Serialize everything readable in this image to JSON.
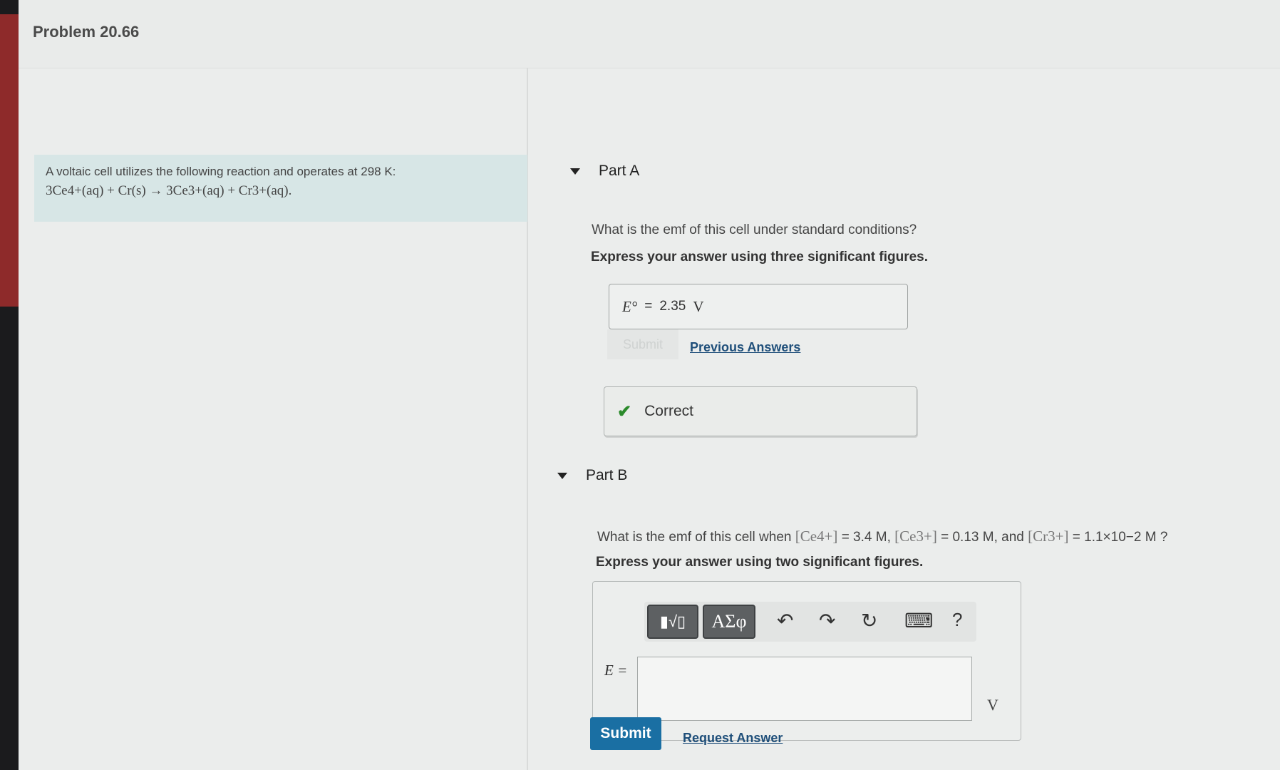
{
  "problem": {
    "title": "Problem 20.66"
  },
  "intro": {
    "text": "A voltaic cell utilizes the following reaction and operates at 298 K:",
    "equation": "3Ce4+(aq) + Cr(s) → 3Ce3+(aq) + Cr3+(aq)."
  },
  "partA": {
    "label": "Part A",
    "question": "What is the emf of this cell under standard conditions?",
    "instruction": "Express your answer using three significant figures.",
    "answer_symbol": "E°",
    "answer_equals": "=",
    "answer_value": "2.35",
    "answer_unit": "V",
    "submit_label": "Submit",
    "previous_answers_label": "Previous Answers",
    "feedback": "Correct"
  },
  "partB": {
    "label": "Part B",
    "question_prefix": "What is the emf of this cell when",
    "ce4_label": "[Ce4+]",
    "ce4_value": "= 3.4 M",
    "ce3_label": "[Ce3+]",
    "ce3_value": "= 0.13 M",
    "and_text": ", and",
    "cr3_label": "[Cr3+]",
    "cr3_value": "= 1.1×10−2 M ?",
    "instruction": "Express your answer using two significant figures.",
    "answer_symbol": "E =",
    "answer_value": "",
    "answer_unit": "V",
    "toolbar": {
      "template_icon": "▮√▯",
      "greek_icon": "ΑΣφ",
      "undo_icon": "↶",
      "redo_icon": "↷",
      "reset_icon": "↻",
      "keyboard_icon": "⌨",
      "help_icon": "?"
    },
    "submit_label": "Submit",
    "request_answer_label": "Request Answer"
  },
  "colors": {
    "submit": "#1a6fa3",
    "check": "#2b8a2b",
    "link": "#1f4f7a",
    "intro_bg": "#d7e6e6"
  }
}
